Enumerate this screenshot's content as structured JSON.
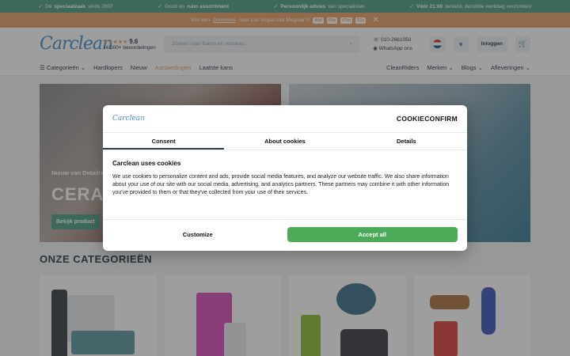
{
  "topbar": {
    "usps": [
      {
        "bold": "",
        "text_a": "Dé",
        "strong": "speciaalzaak",
        "text_b": "sinds 2007"
      },
      {
        "text_a": "Groot en",
        "strong": "ruim assortiment",
        "text_b": ""
      },
      {
        "text_a": "",
        "strong": "Persoonlijk advies",
        "text_b": "van specialisten"
      },
      {
        "text_a": "",
        "strong": "Vóór 21:00",
        "text_b": "besteld, dezelfde werkdag verzonden!"
      }
    ]
  },
  "promo": {
    "text_a": "Win een",
    "link": "droomreis",
    "text_b": "naar Las Vegas met Meguiar's!",
    "countdown": [
      "40d",
      "05u",
      "07m",
      "51s"
    ]
  },
  "header": {
    "logo": "Carclean",
    "score": "9.6",
    "reviews": "14.000+ beoordelingen",
    "search_placeholder": "Zoeken naar foams en voorwas...",
    "phone": "010-2661050",
    "whatsapp": "WhatsApp ons",
    "login": "Inloggen"
  },
  "nav": {
    "left": [
      "Categorieën",
      "Hardlopers",
      "Nieuw",
      "Aanbiedingen",
      "Laatste kans"
    ],
    "right": [
      "CleanRiders",
      "Merken",
      "Blogs",
      "Afleveringen"
    ]
  },
  "hero": {
    "tag": "Nieuw van Detailrs",
    "headline": "CERAMIC",
    "button": "Bekijk product"
  },
  "categories": {
    "title": "ONZE CATEGORIEËN"
  },
  "cookie": {
    "logo": "Carclean",
    "brand": "COOKIECONFIRM",
    "tabs": [
      "Consent",
      "About cookies",
      "Details"
    ],
    "heading": "Carclean uses cookies",
    "body": "We use cookies to personalize content and ads, provide social media features, and analyze our website traffic. We also share information about your use of our site with our social media, advertising, and analytics partners. These partners may combine it with other information you've provided to them or that they've collected from your use of their services.",
    "customize": "Customize",
    "accept": "Accept all"
  },
  "colors": {
    "green": "#4f9e86",
    "orange": "#e6a067",
    "accept": "#4caa58"
  }
}
